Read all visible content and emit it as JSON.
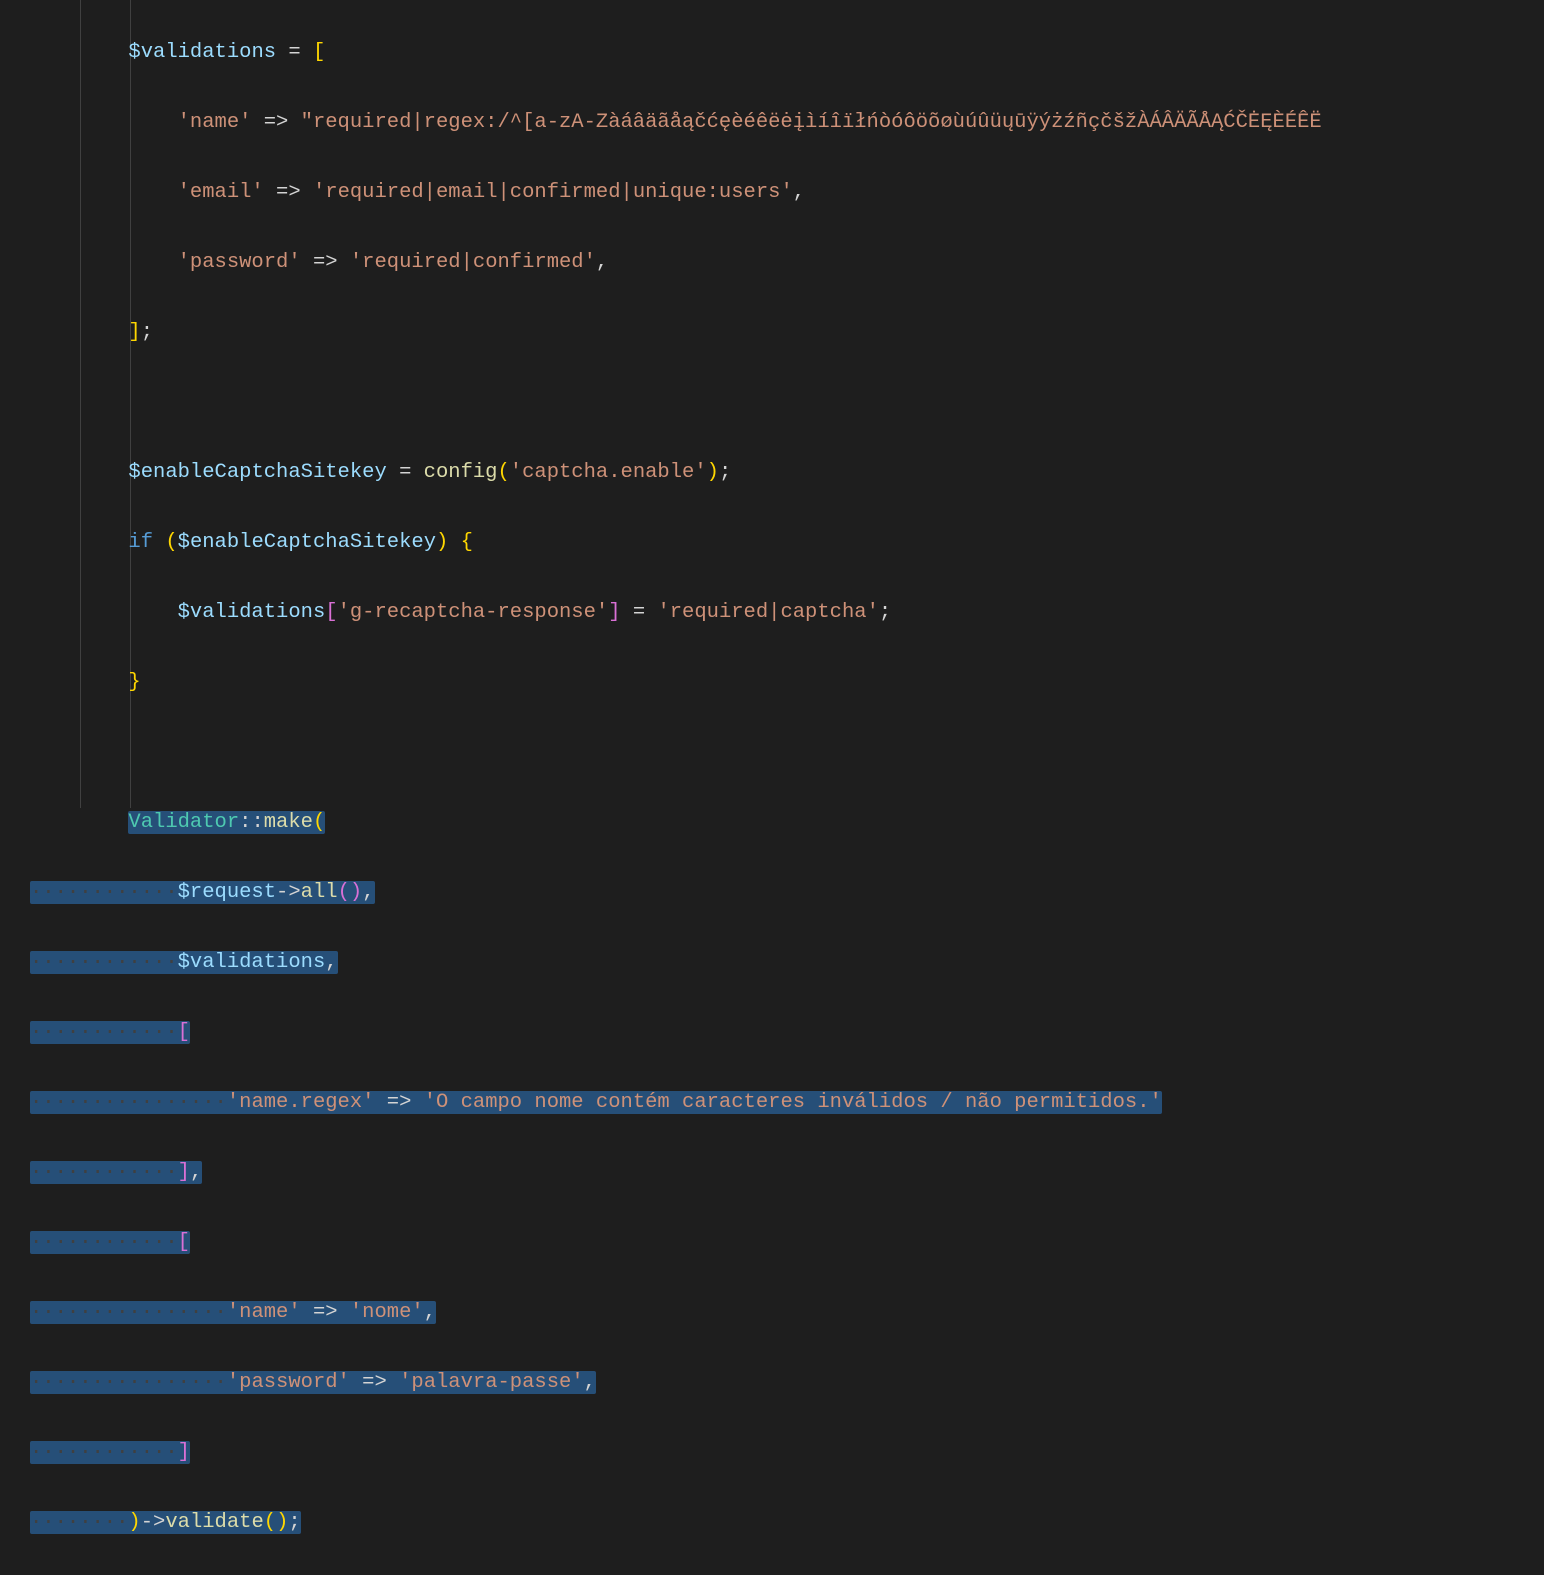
{
  "code": {
    "l1": {
      "var": "$validations",
      "op": " = ",
      "br": "["
    },
    "l2": {
      "key": "'name'",
      "arrow": " => ",
      "val": "\"required|regex:/^[a-zA-ZàáâäãåąčćęèéêëėįìíîïłńòóôöõøùúûüųūÿýżźñçčšžÀÁÂÄÃÅĄĆČĖĘÈÉÊË"
    },
    "l3": {
      "key": "'email'",
      "arrow": " => ",
      "val": "'required|email|confirmed|unique:users'",
      "comma": ","
    },
    "l4": {
      "key": "'password'",
      "arrow": " => ",
      "val": "'required|confirmed'",
      "comma": ","
    },
    "l5": {
      "br": "]",
      "semi": ";"
    },
    "l7": {
      "var": "$enableCaptchaSitekey",
      "op": " = ",
      "fn": "config",
      "open": "(",
      "arg": "'captcha.enable'",
      "close": ")",
      "semi": ";"
    },
    "l8": {
      "kw": "if",
      "sp": " ",
      "open": "(",
      "var": "$enableCaptchaSitekey",
      "close": ")",
      "sp2": " ",
      "brace": "{"
    },
    "l9": {
      "var": "$validations",
      "open": "[",
      "key": "'g-recaptcha-response'",
      "close": "]",
      "op": " = ",
      "val": "'required|captcha'",
      "semi": ";"
    },
    "l10": {
      "brace": "}"
    },
    "l12": {
      "cls": "Validator",
      "dcolon": "::",
      "fn": "make",
      "open": "("
    },
    "l13": {
      "var": "$request",
      "arrow": "->",
      "fn": "all",
      "open": "(",
      "close": ")",
      "comma": ","
    },
    "l14": {
      "var": "$validations",
      "comma": ","
    },
    "l15": {
      "br": "["
    },
    "l16": {
      "key": "'name.regex'",
      "arrow": " => ",
      "val": "'O campo nome contém caracteres inválidos / não permitidos.'"
    },
    "l17": {
      "br": "]",
      "comma": ","
    },
    "l18": {
      "br": "["
    },
    "l19": {
      "key": "'name'",
      "arrow": " => ",
      "val": "'nome'",
      "comma": ","
    },
    "l20": {
      "key": "'password'",
      "arrow": " => ",
      "val": "'palavra-passe'",
      "comma": ","
    },
    "l21": {
      "br": "]"
    },
    "l22": {
      "close": ")",
      "arrow": "->",
      "fn": "validate",
      "open2": "(",
      "close2": ")",
      "semi": ";"
    }
  },
  "indent": {
    "i2": "        ",
    "i3": "            ",
    "i4": "                "
  },
  "wsdots": {
    "d2": "········",
    "d3": "············",
    "d4": "················"
  }
}
